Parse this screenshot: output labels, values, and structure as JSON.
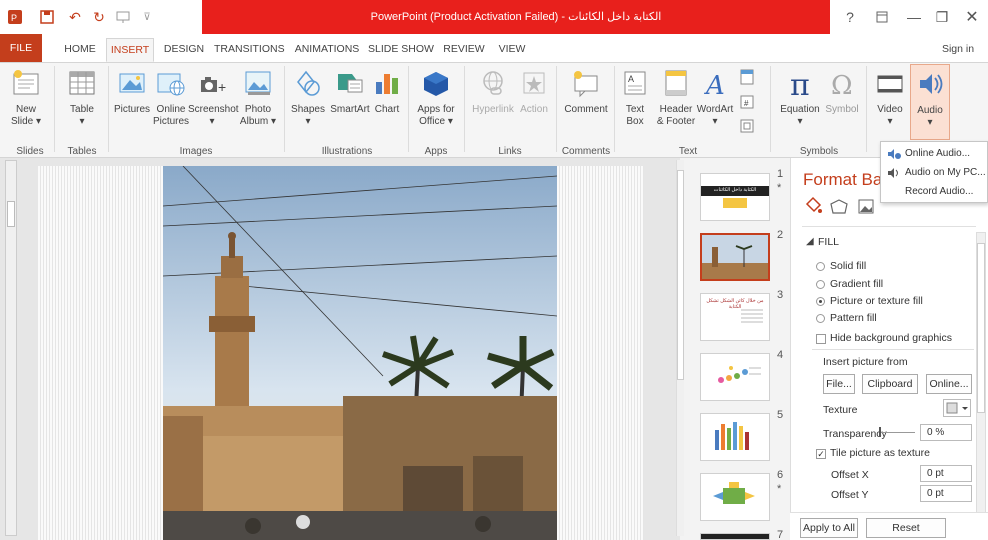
{
  "window": {
    "title": "PowerPoint (Product Activation Failed) - الكتابة داخل الكائنات",
    "help": "?",
    "user": "Sign in"
  },
  "tabs": [
    "FILE",
    "HOME",
    "INSERT",
    "DESIGN",
    "TRANSITIONS",
    "ANIMATIONS",
    "SLIDE SHOW",
    "REVIEW",
    "VIEW"
  ],
  "ribbon": {
    "new_slide": "New",
    "new_slide2": "Slide ▾",
    "table": "Table",
    "table2": "▾",
    "pictures": "Pictures",
    "online_pictures": "Online",
    "online_pictures2": "Pictures",
    "screenshot": "Screenshot",
    "screenshot2": "▾",
    "photo_album": "Photo",
    "photo_album2": "Album ▾",
    "shapes": "Shapes",
    "shapes2": "▾",
    "smartart": "SmartArt",
    "chart": "Chart",
    "apps_for_office": "Apps for",
    "apps_for_office2": "Office ▾",
    "hyperlink": "Hyperlink",
    "action": "Action",
    "comment": "Comment",
    "text_box": "Text",
    "text_box2": "Box",
    "header_footer": "Header",
    "header_footer2": "& Footer",
    "wordart": "WordArt",
    "wordart2": "▾",
    "equation": "Equation",
    "equation2": "▾",
    "symbol": "Symbol",
    "video": "Video",
    "video2": "▾",
    "audio": "Audio",
    "audio2": "▾",
    "groups": {
      "slides": "Slides",
      "tables": "Tables",
      "images": "Images",
      "illustrations": "Illustrations",
      "apps": "Apps",
      "links": "Links",
      "comments": "Comments",
      "text": "Text",
      "symbols": "Symbols"
    }
  },
  "audio_menu": [
    "Online Audio...",
    "Audio on My PC...",
    "Record Audio..."
  ],
  "thumbnails": {
    "numbers": [
      "1",
      "2",
      "3",
      "4",
      "5",
      "6",
      "7"
    ],
    "star": "*",
    "slide1_title": "الكتابة داخل الكائنات",
    "slide3_title": "من خلال كائن الشكل تشكل الكتابة"
  },
  "format_pane": {
    "title": "Format Background",
    "section": "FILL",
    "options": [
      "Solid fill",
      "Gradient fill",
      "Picture or texture fill",
      "Pattern fill"
    ],
    "selected": "Picture or texture fill",
    "hide_graphics": "Hide background graphics",
    "insert_from": "Insert picture from",
    "file_btn": "File...",
    "clipboard_btn": "Clipboard",
    "online_btn": "Online...",
    "texture": "Texture",
    "transparency": "Transparency",
    "transparency_value": "0 %",
    "tile": "Tile picture as texture",
    "offset_x": "Offset X",
    "offset_x_value": "0 pt",
    "offset_y": "Offset Y",
    "offset_y_value": "0 pt",
    "apply_all": "Apply to All",
    "reset": "Reset Background"
  },
  "colors": {
    "accent": "#c43e1c",
    "title_bar": "#e8201c",
    "ribbon_bg": "#f5f5f5"
  }
}
